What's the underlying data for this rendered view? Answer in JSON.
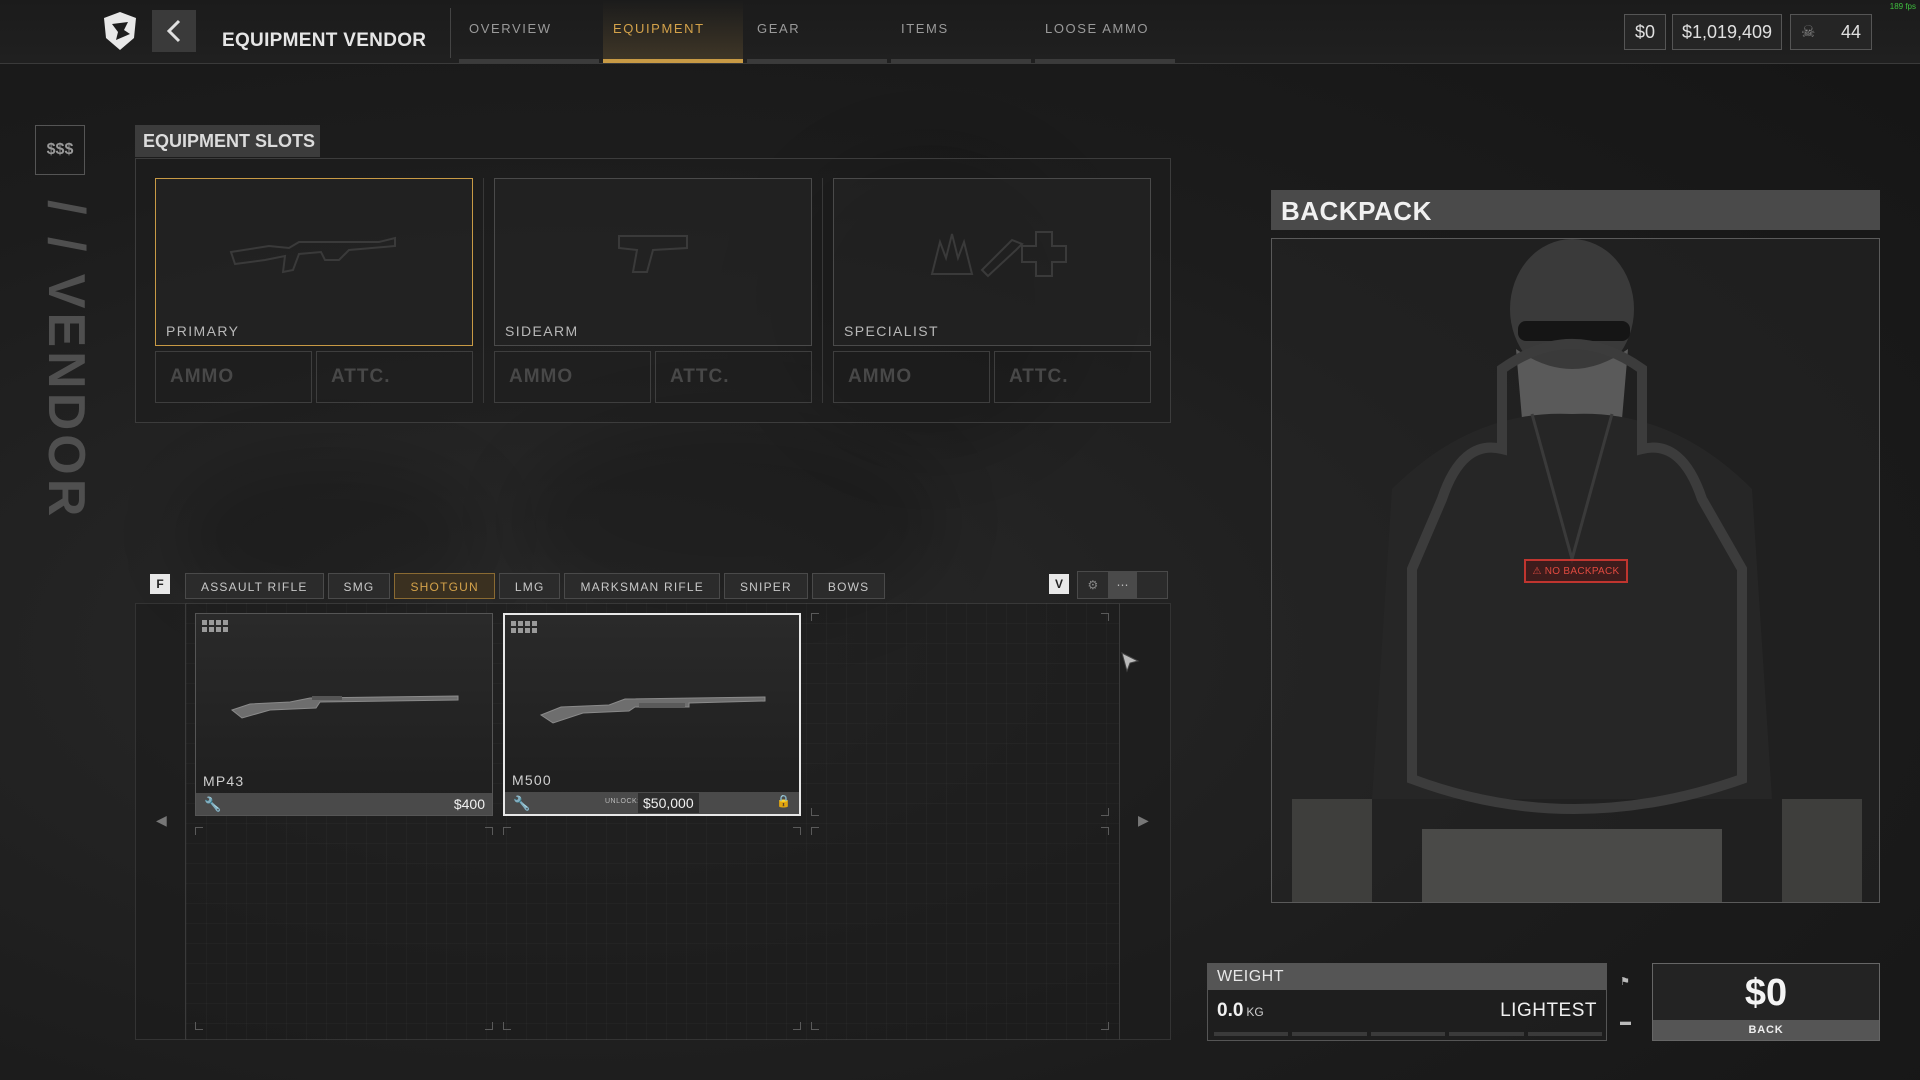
{
  "topbar": {
    "title": "EQUIPMENT VENDOR",
    "tabs": [
      {
        "label": "OVERVIEW"
      },
      {
        "label": "EQUIPMENT"
      },
      {
        "label": "GEAR"
      },
      {
        "label": "ITEMS"
      },
      {
        "label": "LOOSE AMMO"
      }
    ],
    "active_tab": "EQUIPMENT",
    "currency_small": "$0",
    "currency_main": "$1,019,409",
    "level": "44",
    "fps": "189 fps"
  },
  "sidebar": {
    "money_label": "$$$",
    "vertical_label": "/ / VENDOR"
  },
  "equipment_slots": {
    "header": "EQUIPMENT SLOTS",
    "slots": [
      {
        "label": "PRIMARY",
        "ammo": "AMMO",
        "attc": "ATTC.",
        "selected": true
      },
      {
        "label": "SIDEARM",
        "ammo": "AMMO",
        "attc": "ATTC.",
        "selected": false
      },
      {
        "label": "SPECIALIST",
        "ammo": "AMMO",
        "attc": "ATTC.",
        "selected": false
      }
    ]
  },
  "filters": {
    "prev_key": "F",
    "next_key": "V",
    "items": [
      {
        "label": "ASSAULT RIFLE",
        "active": false
      },
      {
        "label": "SMG",
        "active": false
      },
      {
        "label": "SHOTGUN",
        "active": true
      },
      {
        "label": "LMG",
        "active": false
      },
      {
        "label": "MARKSMAN RIFLE",
        "active": false
      },
      {
        "label": "SNIPER",
        "active": false
      },
      {
        "label": "BOWS",
        "active": false
      }
    ]
  },
  "items": [
    {
      "name": "MP43",
      "price": "$400",
      "locked": false
    },
    {
      "name": "M500",
      "unlock_label": "UNLOCK:",
      "price": "$50,000",
      "locked": true
    }
  ],
  "backpack": {
    "header": "BACKPACK",
    "warning": "NO BACKPACK"
  },
  "weight": {
    "header": "WEIGHT",
    "value": "0.0",
    "unit": "KG",
    "class": "LIGHTEST"
  },
  "value": {
    "amount": "$0",
    "footer": "BACK"
  },
  "colors": {
    "accent": "#c89a45",
    "warning": "#c0352f"
  }
}
